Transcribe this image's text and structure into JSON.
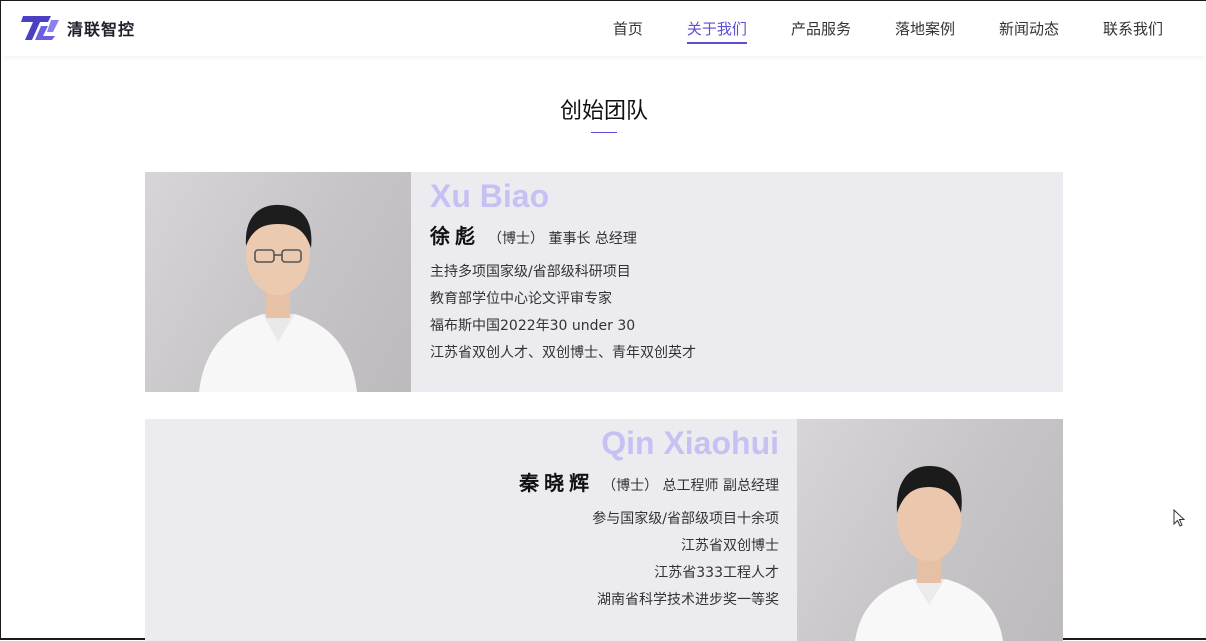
{
  "header": {
    "brand": "清联智控",
    "nav": [
      {
        "label": "首页",
        "active": false
      },
      {
        "label": "关于我们",
        "active": true
      },
      {
        "label": "产品服务",
        "active": false
      },
      {
        "label": "落地案例",
        "active": false
      },
      {
        "label": "新闻动态",
        "active": false
      },
      {
        "label": "联系我们",
        "active": false
      }
    ],
    "accent_color": "#5b4fd4"
  },
  "section": {
    "title": "创始团队"
  },
  "members": [
    {
      "en_name": "Xu Biao",
      "cn_name": "徐彪",
      "title": "（博士） 董事长 总经理",
      "bullets": [
        "主持多项国家级/省部级科研项目",
        "教育部学位中心论文评审专家",
        "福布斯中国2022年30 under 30",
        "江苏省双创人才、双创博士、青年双创英才"
      ]
    },
    {
      "en_name": "Qin Xiaohui",
      "cn_name": "秦晓辉",
      "title": "（博士） 总工程师 副总经理",
      "bullets": [
        "参与国家级/省部级项目十余项",
        "江苏省双创博士",
        "江苏省333工程人才",
        "湖南省科学技术进步奖一等奖"
      ]
    }
  ]
}
